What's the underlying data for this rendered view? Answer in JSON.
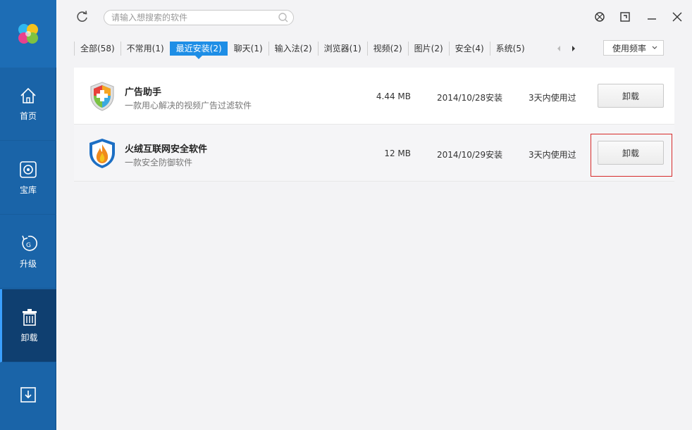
{
  "sidebar": {
    "items": [
      {
        "label": "首页",
        "icon": "home-icon"
      },
      {
        "label": "宝库",
        "icon": "treasury-icon"
      },
      {
        "label": "升级",
        "icon": "upgrade-icon"
      },
      {
        "label": "卸载",
        "icon": "uninstall-icon"
      },
      {
        "label": "",
        "icon": "download-icon"
      }
    ],
    "active": "卸载"
  },
  "search": {
    "placeholder": "请输入想搜索的软件"
  },
  "tabs": [
    {
      "label": "全部(58)"
    },
    {
      "label": "不常用(1)"
    },
    {
      "label": "最近安装(2)",
      "active": true
    },
    {
      "label": "聊天(1)"
    },
    {
      "label": "输入法(2)"
    },
    {
      "label": "浏览器(1)"
    },
    {
      "label": "视频(2)"
    },
    {
      "label": "图片(2)"
    },
    {
      "label": "安全(4)"
    },
    {
      "label": "系统(5)"
    }
  ],
  "sort": {
    "label": "使用频率"
  },
  "apps": [
    {
      "name": "广告助手",
      "desc": "一款用心解决的视频广告过滤软件",
      "size": "4.44 MB",
      "date": "2014/10/28安装",
      "used": "3天内使用过",
      "button": "卸载"
    },
    {
      "name": "火绒互联网安全软件",
      "desc": "一款安全防御软件",
      "size": "12 MB",
      "date": "2014/10/29安装",
      "used": "3天内使用过",
      "button": "卸载"
    }
  ],
  "colors": {
    "sidebar": "#1a64a8",
    "active_tab": "#1e8ee6",
    "highlight": "#d62a2a"
  }
}
